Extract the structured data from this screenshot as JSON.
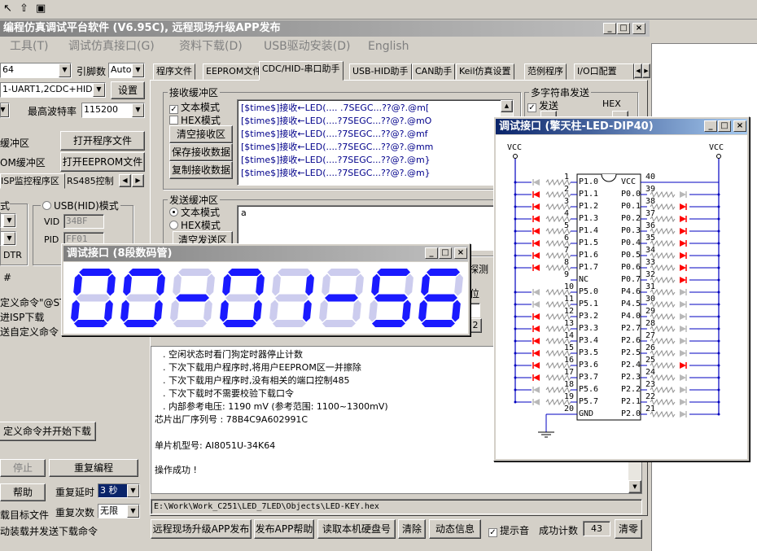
{
  "main_title": "编程仿真调试平台软件 (V6.95C), 远程现场升级APP发布",
  "menu": [
    "工具(T)",
    "调试仿真接口(G)",
    "资料下载(D)",
    "USB驱动安装(D)",
    "English"
  ],
  "left": {
    "chip": "64",
    "pin_label": "引脚数",
    "pin_value": "Auto",
    "port_value": "1-UART1,2CDC+HID",
    "settings": "设置",
    "max_baud_label": "最高波特率",
    "max_baud_value": "115200",
    "prog_buffer": "缓冲区",
    "open_prog": "打开程序文件",
    "eeprom_buffer": "OM缓冲区",
    "open_eeprom": "打开EEPROM文件",
    "tab_isp": "ISP监控程序区",
    "tab_rs485": "RS485控制",
    "mode_label": "式",
    "usb_hid_mode": "USB(HID)模式",
    "vid_label": "VID",
    "vid_value": "34BF",
    "pid_label": "PID",
    "pid_value": "FF01",
    "dtr": "DTR",
    "hash": "#",
    "custom_cmd": "定义命令\"@STC",
    "enter_isp": "进ISP下载",
    "send_custom": "送自定义命令",
    "start_custom_btn": "定义命令并开始下载",
    "stop": "停止",
    "reprogram": "重复编程",
    "help": "帮助",
    "repeat_delay_label": "重复延时",
    "repeat_delay_value": "3 秒",
    "target_file": "载目标文件",
    "repeat_count_label": "重复次数",
    "repeat_count_value": "无限",
    "auto_load": "动装载并发送下载命令"
  },
  "tabs": [
    "程序文件",
    "EEPROM文件",
    "CDC/HID-串口助手",
    "USB-HID助手",
    "CAN助手",
    "Keil仿真设置",
    "范例程序",
    "I/O口配置"
  ],
  "recv": {
    "title": "接收缓冲区",
    "text_mode": "文本模式",
    "hex_mode": "HEX模式",
    "clear": "清空接收区",
    "save": "保存接收数据",
    "copy": "复制接收数据",
    "lines": [
      "[$time$]接收←LED(....  .7SEGC...??@?.@m[",
      "[$time$]接收←LED(....?7SEGC...??@?.@mO",
      "[$time$]接收←LED(....?7SEGC...??@?.@mf",
      "[$time$]接收←LED(....?7SEGC...??@?.@mm",
      "[$time$]接收←LED(....?7SEGC...??@?.@m}",
      "[$time$]接收←LED(....?7SEGC...??@?.@m}"
    ]
  },
  "multi": {
    "title": "多字符串发送",
    "send": "发送",
    "hex": "HEX"
  },
  "send": {
    "title": "发送缓冲区",
    "text_mode": "文本模式",
    "hex_mode": "HEX模式",
    "clear": "清空发送区",
    "content": "a"
  },
  "partial": {
    "detect": "探测",
    "bit": "位",
    "v2": "2"
  },
  "log": {
    "lines": [
      ". 空闲状态时看门狗定时器停止计数",
      ". 下次下载用户程序时,将用户EEPROM区一并擦除",
      ". 下次下载用户程序时,没有相关的端口控制485",
      ". 下次下载时不需要校验下载口令",
      ". 内部参考电压: 1190 mV (参考范围: 1100~1300mV)",
      "芯片出厂序列号 : 78B4C9A602991C",
      "",
      "  单片机型号: AI8051U-34K64",
      "",
      "操作成功 !"
    ]
  },
  "path": "E:\\Work\\Work_C251\\LED_7LED\\Objects\\LED-KEY.hex",
  "bottom": {
    "remote": "远程现场升级APP发布",
    "publish_help": "发布APP帮助",
    "read_disk": "读取本机硬盘号",
    "clear": "清除",
    "dynamic": "动态信息",
    "beep": "提示音",
    "success_label": "成功计数",
    "success_value": "43",
    "reset": "清零"
  },
  "seg_window": {
    "title": "调试接口 (8段数码管)",
    "digits": "00-01-56"
  },
  "dip_window": {
    "title": "调试接口 (擎天柱-LED-DIP40)",
    "vcc": "VCC",
    "chip_vcc": "VCC",
    "gnd": "GND",
    "left_pins": [
      {
        "n": "1",
        "name": "P1.0"
      },
      {
        "n": "2",
        "name": "P1.1"
      },
      {
        "n": "3",
        "name": "P1.2"
      },
      {
        "n": "4",
        "name": "P1.3"
      },
      {
        "n": "5",
        "name": "P1.4"
      },
      {
        "n": "6",
        "name": "P1.5"
      },
      {
        "n": "7",
        "name": "P1.6"
      },
      {
        "n": "8",
        "name": "P1.7"
      },
      {
        "n": "9",
        "name": "NC"
      },
      {
        "n": "10",
        "name": "P5.0"
      },
      {
        "n": "11",
        "name": "P5.1"
      },
      {
        "n": "12",
        "name": "P3.2"
      },
      {
        "n": "13",
        "name": "P3.3"
      },
      {
        "n": "14",
        "name": "P3.4"
      },
      {
        "n": "15",
        "name": "P3.5"
      },
      {
        "n": "16",
        "name": "P3.6"
      },
      {
        "n": "17",
        "name": "P3.7"
      },
      {
        "n": "18",
        "name": "P5.6"
      },
      {
        "n": "19",
        "name": "P5.7"
      },
      {
        "n": "20",
        "name": "GND"
      }
    ],
    "right_pins": [
      {
        "n": "40",
        "name": "VCC"
      },
      {
        "n": "39",
        "name": "P0.0"
      },
      {
        "n": "38",
        "name": "P0.1"
      },
      {
        "n": "37",
        "name": "P0.2"
      },
      {
        "n": "36",
        "name": "P0.3"
      },
      {
        "n": "35",
        "name": "P0.4"
      },
      {
        "n": "34",
        "name": "P0.5"
      },
      {
        "n": "33",
        "name": "P0.6"
      },
      {
        "n": "32",
        "name": "P0.7"
      },
      {
        "n": "31",
        "name": "P4.6"
      },
      {
        "n": "30",
        "name": "P4.5"
      },
      {
        "n": "29",
        "name": "P4.0"
      },
      {
        "n": "28",
        "name": "P2.7"
      },
      {
        "n": "27",
        "name": "P2.6"
      },
      {
        "n": "26",
        "name": "P2.5"
      },
      {
        "n": "25",
        "name": "P2.4"
      },
      {
        "n": "24",
        "name": "P2.3"
      },
      {
        "n": "23",
        "name": "P2.2"
      },
      {
        "n": "22",
        "name": "P2.1"
      },
      {
        "n": "21",
        "name": "P2.0"
      }
    ],
    "left_leds": [
      "off",
      "on",
      "on",
      "on",
      "on",
      "on",
      "on",
      "on",
      "none",
      "off",
      "off",
      "on",
      "on",
      "on",
      "on",
      "on",
      "on",
      "off",
      "off",
      "none"
    ],
    "right_leds": [
      "none",
      "off",
      "on",
      "on",
      "on",
      "on",
      "on",
      "on",
      "on",
      "off",
      "off",
      "off",
      "off",
      "off",
      "off",
      "on",
      "off",
      "off",
      "off",
      "off"
    ],
    "led_on_color": "#ff0000",
    "led_off_color": "#b8b8b8"
  },
  "colors": {
    "title_active": "#0a246a",
    "title_active2": "#a6caf0",
    "title_inactive": "#808080",
    "title_inactive2": "#c0c0c0",
    "seg_on": "#1a1aff",
    "seg_off": "#ccccee",
    "seg_bg": "#ffffff"
  }
}
